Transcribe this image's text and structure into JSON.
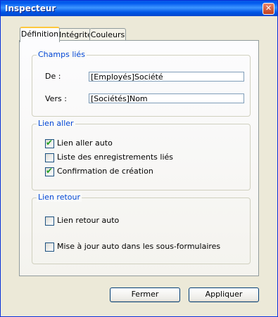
{
  "window": {
    "title": "Inspecteur"
  },
  "tabs": [
    {
      "label": "Définition",
      "active": true
    },
    {
      "label": "Intégrité",
      "active": false
    },
    {
      "label": "Couleurs",
      "active": false
    }
  ],
  "champs_lies": {
    "legend": "Champs liés",
    "de_label": "De :",
    "de_value": "[Employés]Société",
    "vers_label": "Vers :",
    "vers_value": "[Sociétés]Nom"
  },
  "lien_aller": {
    "legend": "Lien aller",
    "options": [
      {
        "label": "Lien aller auto",
        "checked": true
      },
      {
        "label": "Liste des enregistrements liés",
        "checked": false
      },
      {
        "label": "Confirmation de création",
        "checked": true
      }
    ]
  },
  "lien_retour": {
    "legend": "Lien retour",
    "options": [
      {
        "label": "Lien retour auto",
        "checked": false
      },
      {
        "label": "Mise à jour auto dans les sous-formulaires",
        "checked": false
      }
    ]
  },
  "buttons": {
    "close": "Fermer",
    "apply": "Appliquer"
  },
  "colors": {
    "accent": "#0046D5",
    "titlebar": "#0058EE",
    "checkmark": "#21A121"
  }
}
